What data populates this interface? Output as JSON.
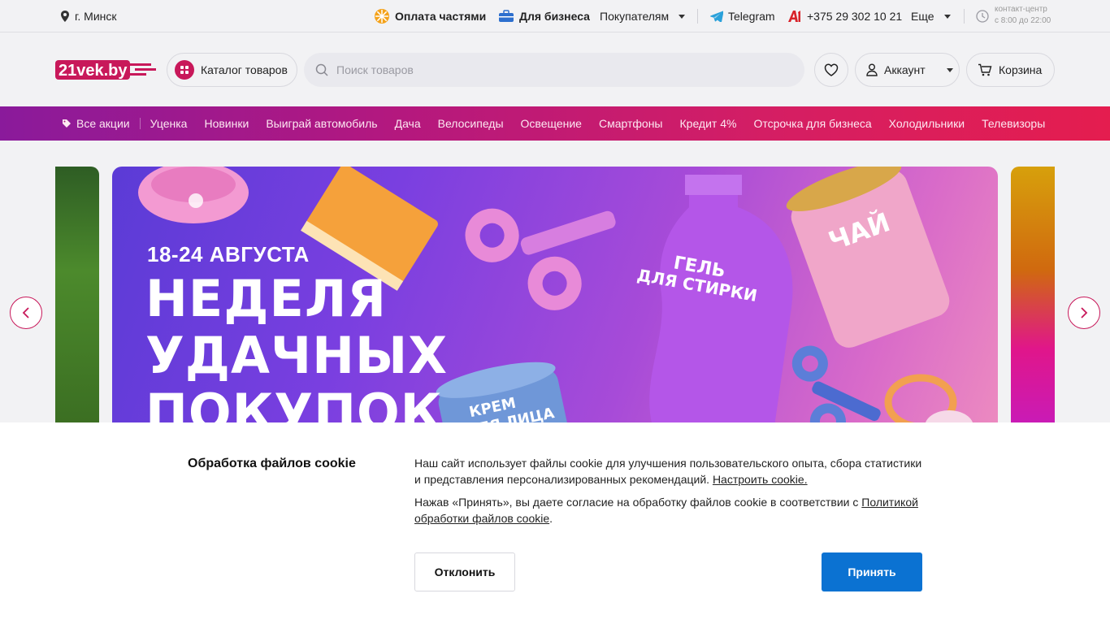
{
  "topbar": {
    "city": "г. Минск",
    "installments": "Оплата частями",
    "business": "Для бизнеса",
    "buyers": "Покупателям",
    "telegram": "Telegram",
    "phone": "+375 29 302 10 21",
    "more": "Еще",
    "contact_label": "контакт-центр",
    "contact_hours": "с 8:00 до 22:00"
  },
  "header": {
    "logo_text": "21vek.by",
    "catalog": "Каталог товаров",
    "search_placeholder": "Поиск товаров",
    "account": "Аккаунт",
    "cart": "Корзина"
  },
  "promo_nav": {
    "all_promos": "Все акции",
    "items": [
      "Уценка",
      "Новинки",
      "Выиграй автомобиль",
      "Дача",
      "Велосипеды",
      "Освещение",
      "Смартфоны",
      "Кредит 4%",
      "Отсрочка для бизнеса",
      "Холодильники",
      "Телевизоры"
    ]
  },
  "banner": {
    "date": "18-24 АВГУСТА",
    "title_line1": "НЕДЕЛЯ",
    "title_line2": "УДАЧНЫХ",
    "title_line3": "ПОКУПОК",
    "bottle_text_1": "ГЕЛЬ",
    "bottle_text_2": "ДЛЯ СТИРКИ",
    "can_text": "ЧАЙ",
    "jar_text_1": "КРЕМ",
    "jar_text_2": "ДЛЯ ЛИЦА"
  },
  "cookie": {
    "title": "Обработка файлов cookie",
    "text1": "Наш сайт использует файлы cookie для улучшения пользовательского опыта, сбора статистики и представления персонализированных рекомендаций.",
    "configure_link": "Настроить cookie.",
    "text2": "Нажав «Принять», вы даете согласие на обработку файлов cookie в соответствии с",
    "policy_link": "Политикой обработки файлов cookie",
    "decline": "Отклонить",
    "accept": "Принять"
  },
  "colors": {
    "brand": "#c8185a",
    "accept_button": "#0b72d2",
    "telegram": "#2aa1da"
  }
}
